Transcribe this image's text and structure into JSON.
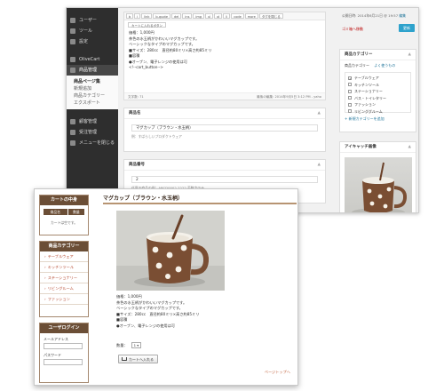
{
  "admin": {
    "sidebar": {
      "items": [
        {
          "label": "ユーザー"
        },
        {
          "label": "ツール"
        },
        {
          "label": "設定"
        },
        {
          "label": "OliveCart"
        },
        {
          "label": "商品管理"
        }
      ],
      "submenu": {
        "heading": "商品ページ集",
        "items": [
          "新規追加",
          "商品カテゴリー",
          "エクスポート"
        ]
      },
      "items2": [
        {
          "label": "顧客管理"
        },
        {
          "label": "受注管理"
        },
        {
          "label": "メニューを閉じる"
        }
      ]
    },
    "editor": {
      "toolbar": [
        "b",
        "i",
        "link",
        "b-quote",
        "del",
        "ins",
        "img",
        "ul",
        "ol",
        "li",
        "code",
        "more",
        "タグを閉じる"
      ],
      "cart_button": "カートに入れるボタン",
      "content_lines": [
        "価格：1,000円",
        "茶色の水玉柄がかわいいマグカップです。",
        "ベーシックなタイプのマグカップです。",
        "■サイズ：280cc　直径約80ミリ×高さ約85ミリ",
        "■容積",
        "●オーブン、電子レンジの使用は可",
        "<!--cart_button-->"
      ],
      "word_count": "文字数: 71",
      "last_edited": "最後の編集: 2014年9月5日 3:12 PM - yaho"
    },
    "product_name_box": {
      "title": "商品名",
      "value": "マグカップ（ブラウン・水玉柄）",
      "hint": "例：すばらしいプロダクトウェア"
    },
    "product_number_box": {
      "title": "商品番号",
      "value": "2",
      "hint": "任意の商品の例：ABCD0002-2222 英数字のみ"
    },
    "publish": {
      "date_label": "公開日時: 2014年6月21日 @ 19:57",
      "edit_link": "編集",
      "trash": "ゴミ箱へ移動",
      "update": "更新"
    },
    "category_box": {
      "title": "商品カテゴリー",
      "tab_all": "商品カテゴリー",
      "tab_popular": "よく使うもの",
      "items": [
        {
          "label": "テーブルウェア",
          "checked": true
        },
        {
          "label": "キッチンツール",
          "checked": false
        },
        {
          "label": "ステーショナリー",
          "checked": false
        },
        {
          "label": "バス・トイレタリー",
          "checked": false
        },
        {
          "label": "ファッション",
          "checked": false
        },
        {
          "label": "リビンググルーム",
          "checked": false
        }
      ],
      "add_link": "+ 新規カテゴリーを追加"
    },
    "eyecatch_box": {
      "title": "アイキャッチ画像"
    }
  },
  "store": {
    "cart_widget": {
      "title": "カートの中身",
      "col_name": "商品名",
      "col_qty": "数量",
      "empty_text": "カートは空です。"
    },
    "category_widget": {
      "title": "商品カテゴリー",
      "items": [
        "テーブルウェア",
        "キッチンツール",
        "ステーショナリー",
        "リビングルーム",
        "ファッション"
      ]
    },
    "login_widget": {
      "title": "ユーザログイン",
      "email_label": "メールアドレス",
      "password_label": "パスワード"
    },
    "product": {
      "title": "マグカップ（ブラウン・水玉柄）",
      "description_lines": [
        "価格：1,000円",
        "茶色の水玉柄がかわいいマグカップです。",
        "ベーシックなタイプのマグカップです。",
        "■サイズ：280cc　直径約80ミリ×高さ約85ミリ",
        "■容積",
        "●オーブン、電子レンジの使用は可"
      ],
      "qty_label": "数量：",
      "qty_value": "1",
      "add_to_cart": "カートへ入れる",
      "page_top": "ページトップへ"
    }
  },
  "colors": {
    "brown_dark": "#6b4e36",
    "brown_line": "#b79472",
    "link_red": "#b5472e",
    "wp_sidebar": "#2e2e2e",
    "wp_blue": "#2ea2cc"
  }
}
